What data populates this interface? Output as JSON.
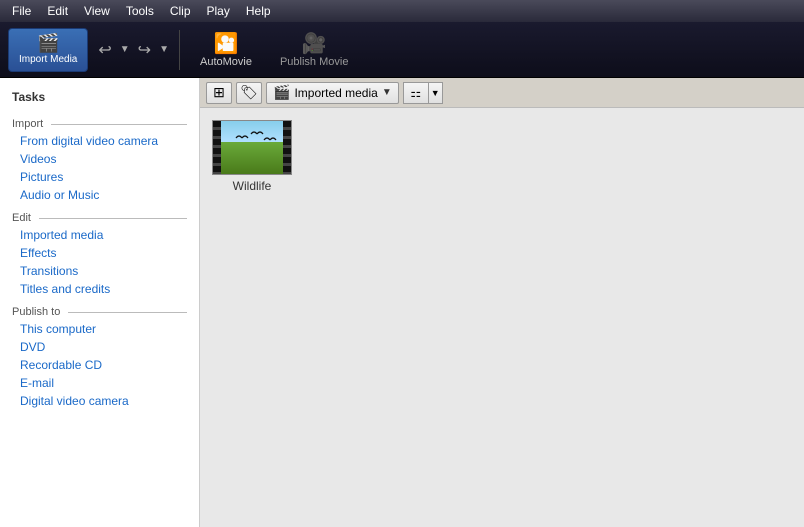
{
  "menu": {
    "items": [
      "File",
      "Edit",
      "View",
      "Tools",
      "Clip",
      "Play",
      "Help"
    ]
  },
  "toolbar": {
    "import_label": "Import Media",
    "automovie_label": "AutoMovie",
    "publish_label": "Publish Movie",
    "undo_title": "Undo",
    "redo_title": "Redo"
  },
  "tasks": {
    "header": "Tasks",
    "import_section": "Import",
    "import_links": [
      "From digital video camera",
      "Videos",
      "Pictures",
      "Audio or Music"
    ],
    "edit_section": "Edit",
    "edit_links": [
      "Imported media",
      "Effects",
      "Transitions",
      "Titles and credits"
    ],
    "publish_section": "Publish to",
    "publish_links": [
      "This computer",
      "DVD",
      "Recordable CD",
      "E-mail",
      "Digital video camera"
    ]
  },
  "content_toolbar": {
    "view_btn_title": "View thumbnails",
    "tag_btn_title": "Tag and caption",
    "imported_media_label": "Imported media",
    "view_options_title": "View options"
  },
  "media_items": [
    {
      "id": 1,
      "label": "Wildlife"
    }
  ]
}
